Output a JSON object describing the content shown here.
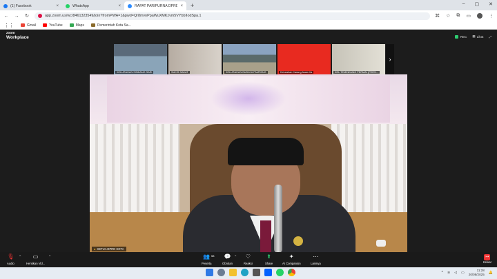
{
  "browser": {
    "tabs": [
      {
        "title": "(1) Facebook",
        "color": "#1877f2"
      },
      {
        "title": "WhatsApp",
        "color": "#25d366"
      },
      {
        "title": "RAPAT PARIPURNA DPRD K",
        "color": "#2d8cff"
      }
    ],
    "url": "app.zoom.us/wc/8461323549/join?fromPWA=1&pwd=Qr8mvnPpaWuXMKzvm5VYbbIIodSpa.1",
    "bookmarks": [
      {
        "label": "Gmail",
        "color": "#ea4335"
      },
      {
        "label": "YouTube",
        "color": "#ff0000"
      },
      {
        "label": "Maps",
        "color": "#34a853"
      },
      {
        "label": "Pemerintah Kota Sa...",
        "color": "#8a6a2a"
      }
    ]
  },
  "zoom": {
    "logo_top": "zoom",
    "logo_bottom": "Workplace",
    "rec_label": "REC",
    "view_label": "Lihat",
    "thumbnails": [
      "KELURAHAN SINDANG SARI",
      "SUKIS SAKAT",
      "KELURAHAN BUDAYA PAMPANG",
      "Kelurahan Karang Asam Ila",
      "KEL.TEMINDUNG PERMAI (PERS..."
    ],
    "main_speaker": "KETUA DPRD KOTA",
    "controls": {
      "audio": "Audio",
      "video": "Hentikan Vid...",
      "participants": "Peserta",
      "participants_count": "58",
      "chat": "Obrolan",
      "reactions": "Reaksi",
      "share": "Share",
      "ai": "AI Companion",
      "more": "Lainnya",
      "leave": "Keluar"
    }
  },
  "taskbar": {
    "time": "11:28",
    "date": "20/08/2025"
  }
}
